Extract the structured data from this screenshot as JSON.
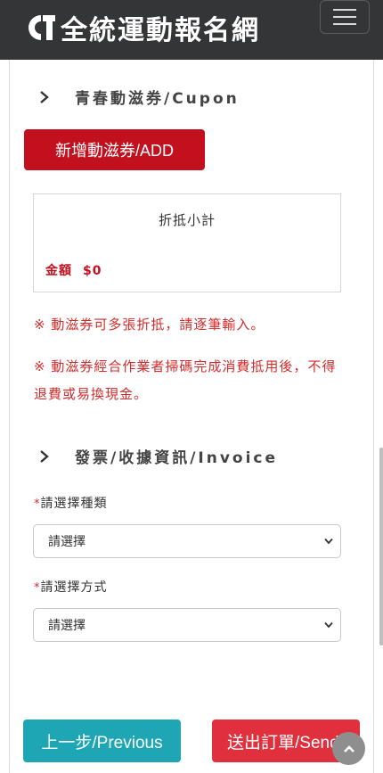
{
  "brand": {
    "name": "全統運動報名網",
    "logo_icon": "ct-logo-icon"
  },
  "nav": {
    "toggle_icon": "hamburger-icon"
  },
  "coupon_section": {
    "title": "青春動滋券/Cupon",
    "add_button": "新增動滋券/ADD",
    "subtotal_title": "折抵小計",
    "amount_label": "金額",
    "amount_value": "$0",
    "note1": "※ 動滋券可多張折抵，請逐筆輸入。",
    "note2": "※ 動滋券經合作業者掃碼完成消費抵用後，不得退費或易換現金。"
  },
  "invoice_section": {
    "title": "發票/收據資訊/Invoice",
    "fields": [
      {
        "required_mark": "*",
        "label": "請選擇種類",
        "value": "請選擇"
      },
      {
        "required_mark": "*",
        "label": "請選擇方式",
        "value": "請選擇"
      }
    ]
  },
  "footer": {
    "prev_button": "上一步/Previous",
    "send_button": "送出訂單/Send"
  },
  "colors": {
    "navbar": "#343536",
    "accent_red": "#c3101e",
    "note_red": "#d42b2b",
    "teal": "#1fa6b5"
  }
}
